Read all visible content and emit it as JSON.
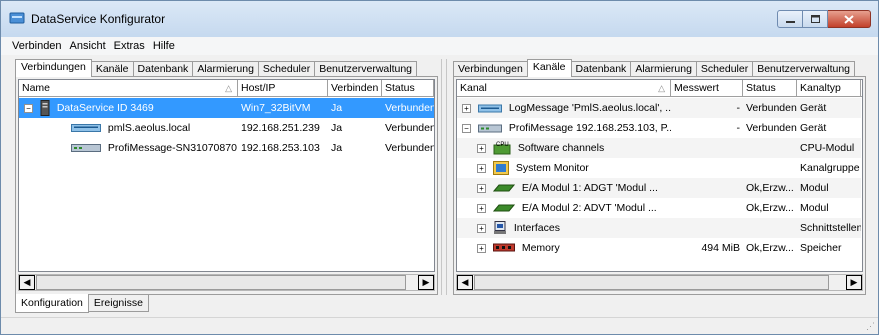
{
  "window": {
    "title": "DataService Konfigurator"
  },
  "menu": [
    "Verbinden",
    "Ansicht",
    "Extras",
    "Hilfe"
  ],
  "left_pane": {
    "tabs": [
      "Verbindungen",
      "Kanäle",
      "Datenbank",
      "Alarmierung",
      "Scheduler",
      "Benutzerverwaltung"
    ],
    "active_tab": "Verbindungen",
    "columns": [
      "Name",
      "Host/IP",
      "Verbinden",
      "Status"
    ],
    "rows": [
      {
        "name": "DataService ID 3469",
        "host": "Win7_32BitVM",
        "verbinden": "Ja",
        "status": "Verbunden",
        "icon": "server-icon",
        "expanded": "⊟"
      },
      {
        "name": "pmlS.aeolus.local",
        "host": "192.168.251.239",
        "verbinden": "Ja",
        "status": "Verbunden",
        "icon": "network-device-icon"
      },
      {
        "name": "ProfiMessage-SN31070870",
        "host": "192.168.253.103",
        "verbinden": "Ja",
        "status": "Verbunden",
        "icon": "profimessage-device-icon"
      }
    ]
  },
  "right_pane": {
    "tabs": [
      "Verbindungen",
      "Kanäle",
      "Datenbank",
      "Alarmierung",
      "Scheduler",
      "Benutzerverwaltung"
    ],
    "active_tab": "Kanäle",
    "columns": [
      "Kanal",
      "Messwert",
      "Status",
      "Kanaltyp"
    ],
    "rows": [
      {
        "kanal": "LogMessage 'PmlS.aeolus.local', ...",
        "messwert": "-",
        "status": "Verbunden",
        "typ": "Gerät",
        "icon": "network-device-icon",
        "exp": "+"
      },
      {
        "kanal": "ProfiMessage 192.168.253.103, P...",
        "messwert": "-",
        "status": "Verbunden",
        "typ": "Gerät",
        "icon": "profimessage-device-icon",
        "exp": "−"
      },
      {
        "kanal": "Software channels",
        "messwert": "",
        "status": "",
        "typ": "CPU-Modul",
        "icon": "cpu-icon",
        "exp": "+"
      },
      {
        "kanal": "System Monitor",
        "messwert": "",
        "status": "",
        "typ": "Kanalgruppe",
        "icon": "system-monitor-icon",
        "exp": "+"
      },
      {
        "kanal": "E/A Modul  1: ADGT 'Modul ...",
        "messwert": "",
        "status": "Ok,Erzw...",
        "typ": "Modul",
        "icon": "io-module-icon",
        "exp": "+"
      },
      {
        "kanal": "E/A Modul  2: ADVT 'Modul ...",
        "messwert": "",
        "status": "Ok,Erzw...",
        "typ": "Modul",
        "icon": "io-module-icon",
        "exp": "+"
      },
      {
        "kanal": "Interfaces",
        "messwert": "",
        "status": "",
        "typ": "Schnittstellen",
        "icon": "interfaces-icon",
        "exp": "+"
      },
      {
        "kanal": "Memory",
        "messwert": "494 MiB",
        "status": "Ok,Erzw...",
        "typ": "Speicher",
        "icon": "memory-icon",
        "exp": "+"
      }
    ]
  },
  "bottom_tabs": [
    "Konfiguration",
    "Ereignisse"
  ],
  "colors": {
    "selection": "#3399ff",
    "title_bg": "#c5d9ef",
    "close_button": "#c2402a"
  }
}
